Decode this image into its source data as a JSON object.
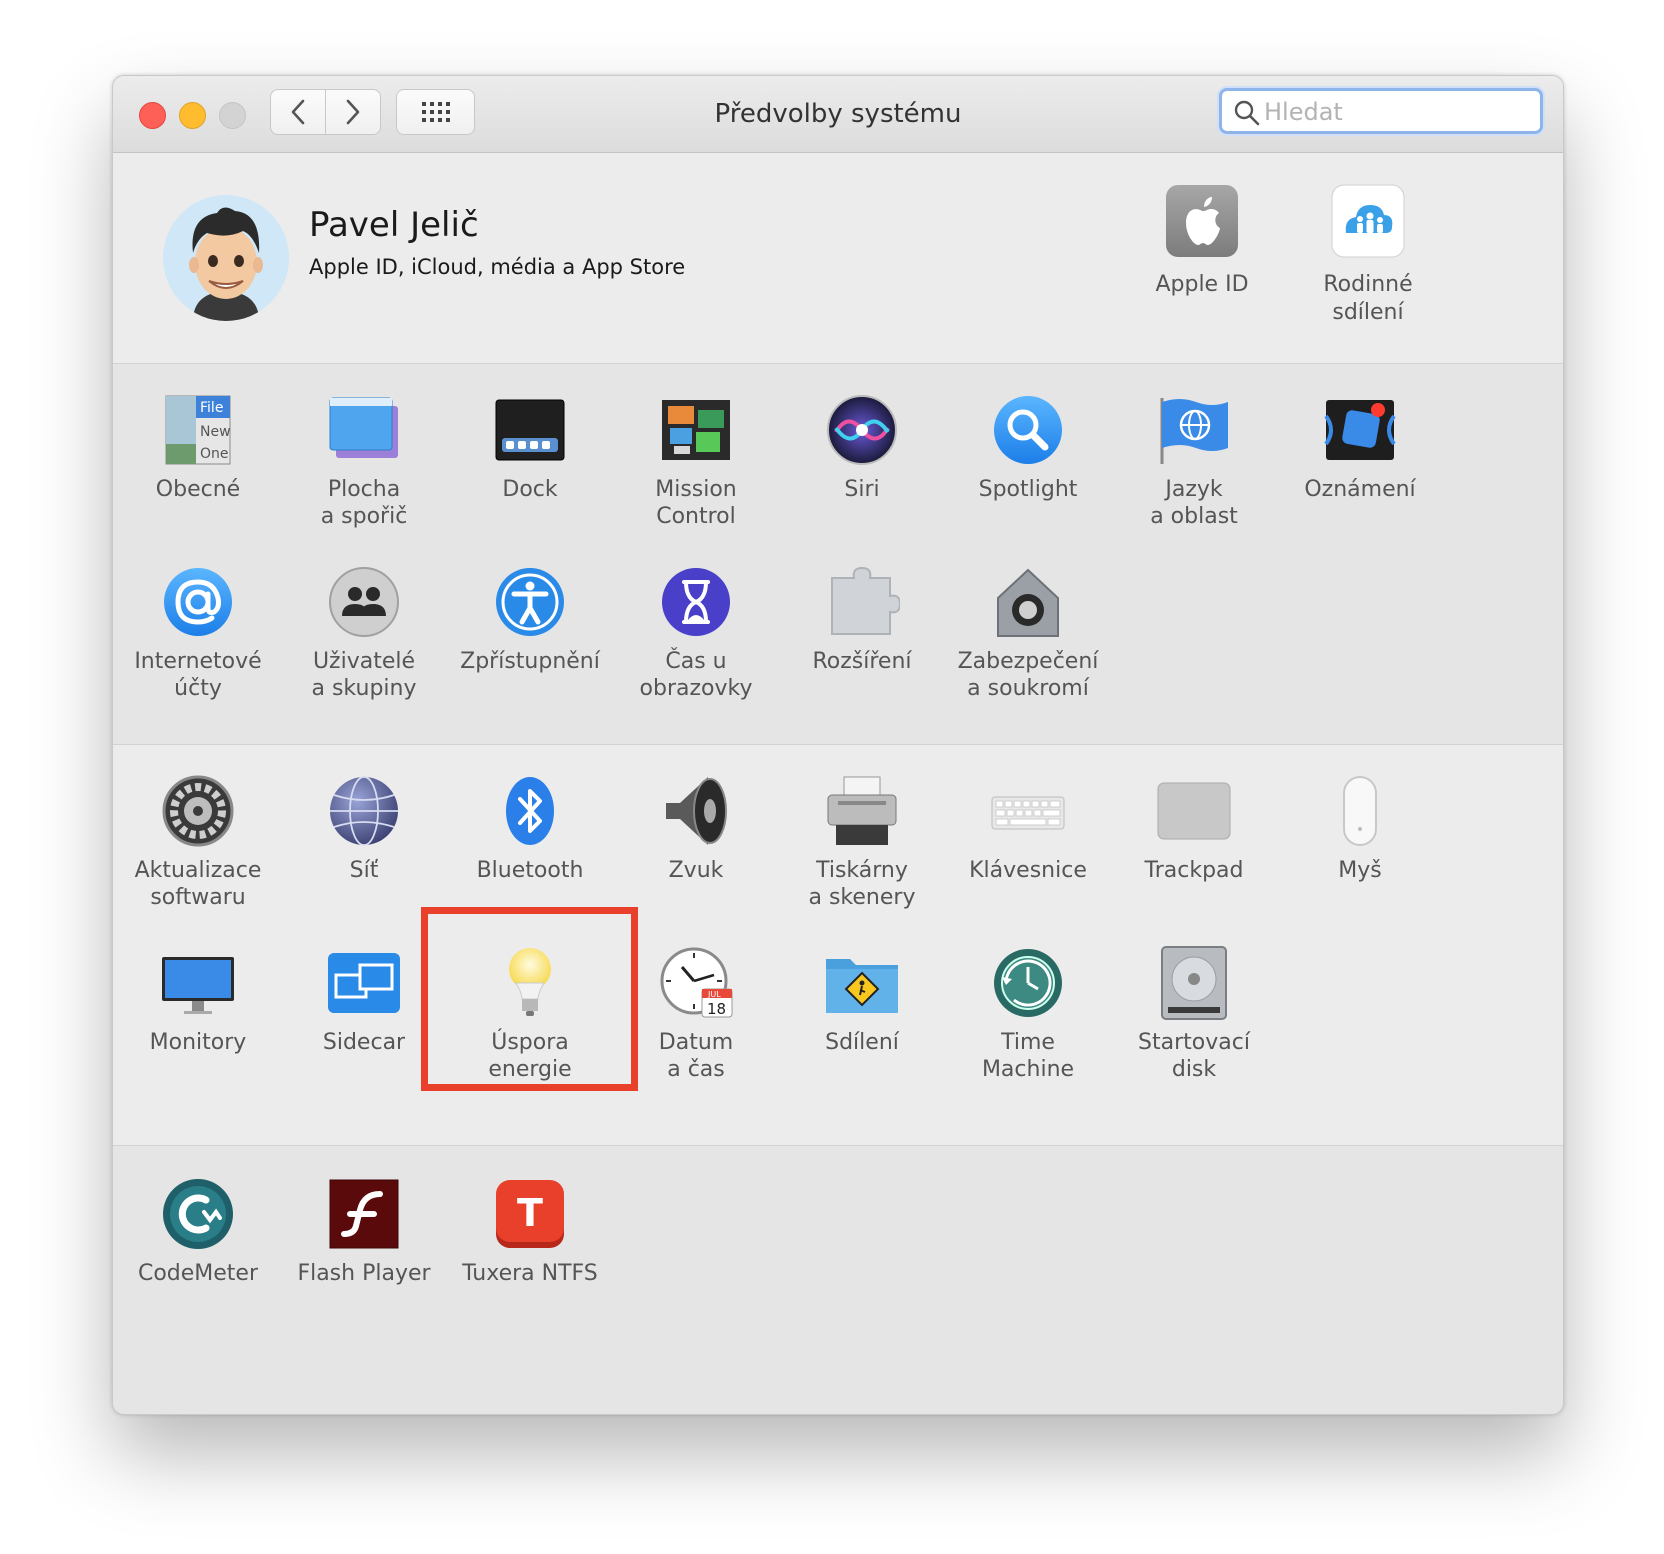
{
  "window": {
    "title": "Předvolby systému"
  },
  "search": {
    "placeholder": "Hledat"
  },
  "profile": {
    "name": "Pavel Jelič",
    "subtitle": "Apple ID, iCloud, média a App Store",
    "tiles": [
      {
        "label": "Apple ID",
        "icon": "apple-logo-icon"
      },
      {
        "label": "Rodinné\nsdílení",
        "icon": "family-sharing-icon"
      }
    ]
  },
  "row1": [
    {
      "label": "Obecné",
      "icon": "general-icon"
    },
    {
      "label": "Plocha\na spořič",
      "icon": "desktop-screensaver-icon"
    },
    {
      "label": "Dock",
      "icon": "dock-icon"
    },
    {
      "label": "Mission\nControl",
      "icon": "mission-control-icon"
    },
    {
      "label": "Siri",
      "icon": "siri-icon"
    },
    {
      "label": "Spotlight",
      "icon": "spotlight-icon"
    },
    {
      "label": "Jazyk\na oblast",
      "icon": "language-region-icon"
    },
    {
      "label": "Oznámení",
      "icon": "notifications-icon"
    }
  ],
  "row2": [
    {
      "label": "Internetové\núčty",
      "icon": "internet-accounts-icon"
    },
    {
      "label": "Uživatelé\na skupiny",
      "icon": "users-groups-icon"
    },
    {
      "label": "Zpřístupnění",
      "icon": "accessibility-icon"
    },
    {
      "label": "Čas u obrazovky",
      "icon": "screen-time-icon"
    },
    {
      "label": "Rozšíření",
      "icon": "extensions-icon"
    },
    {
      "label": "Zabezpečení\na soukromí",
      "icon": "security-privacy-icon"
    }
  ],
  "row3": [
    {
      "label": "Aktualizace\nsoftwaru",
      "icon": "software-update-icon"
    },
    {
      "label": "Síť",
      "icon": "network-icon"
    },
    {
      "label": "Bluetooth",
      "icon": "bluetooth-icon"
    },
    {
      "label": "Zvuk",
      "icon": "sound-icon"
    },
    {
      "label": "Tiskárny\na skenery",
      "icon": "printers-scanners-icon"
    },
    {
      "label": "Klávesnice",
      "icon": "keyboard-icon"
    },
    {
      "label": "Trackpad",
      "icon": "trackpad-icon"
    },
    {
      "label": "Myš",
      "icon": "mouse-icon"
    }
  ],
  "row4": [
    {
      "label": "Monitory",
      "icon": "displays-icon"
    },
    {
      "label": "Sidecar",
      "icon": "sidecar-icon"
    },
    {
      "label": "Úspora\nenergie",
      "icon": "energy-saver-icon"
    },
    {
      "label": "Datum\na čas",
      "icon": "date-time-icon"
    },
    {
      "label": "Sdílení",
      "icon": "sharing-icon"
    },
    {
      "label": "Time\nMachine",
      "icon": "time-machine-icon"
    },
    {
      "label": "Startovací\ndisk",
      "icon": "startup-disk-icon"
    }
  ],
  "row5": [
    {
      "label": "CodeMeter",
      "icon": "codemeter-icon"
    },
    {
      "label": "Flash Player",
      "icon": "flash-player-icon"
    },
    {
      "label": "Tuxera NTFS",
      "icon": "tuxera-ntfs-icon"
    }
  ],
  "icon_text": {
    "general_file": "File",
    "general_new": "New",
    "general_one": "One",
    "calendar_month": "JUL",
    "calendar_day": "18",
    "tuxera_letter": "T"
  },
  "colors": {
    "highlight": "#e8402a",
    "search_focus": "#8fb4ea",
    "label": "#555555"
  }
}
